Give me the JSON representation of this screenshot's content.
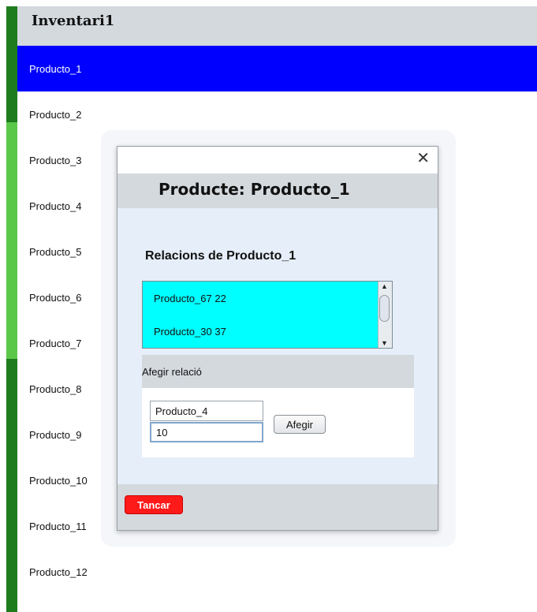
{
  "app": {
    "title": "Inventari1"
  },
  "products": [
    "Producto_1",
    "Producto_2",
    "Producto_3",
    "Producto_4",
    "Producto_5",
    "Producto_6",
    "Producto_7",
    "Producto_8",
    "Producto_9",
    "Producto_10",
    "Producto_11",
    "Producto_12"
  ],
  "selected_product": "Producto_1",
  "dialog": {
    "close_symbol": "✕",
    "title": "Producte:  Producto_1",
    "relations_title": "Relacions de  Producto_1",
    "relations": [
      "Producto_67  22",
      "Producto_30  37"
    ],
    "add_section_label": "Afegir relació",
    "product_input_value": "Producto_4",
    "quantity_input_value": "10",
    "add_button_label": "Afegir",
    "close_button_label": "Tancar"
  },
  "colors": {
    "selection": "#0000ff",
    "relations_bg": "#00ffff",
    "close_button": "#ff1a1a",
    "strip_dark": "#1e7b1e",
    "strip_light": "#5cc84a"
  }
}
